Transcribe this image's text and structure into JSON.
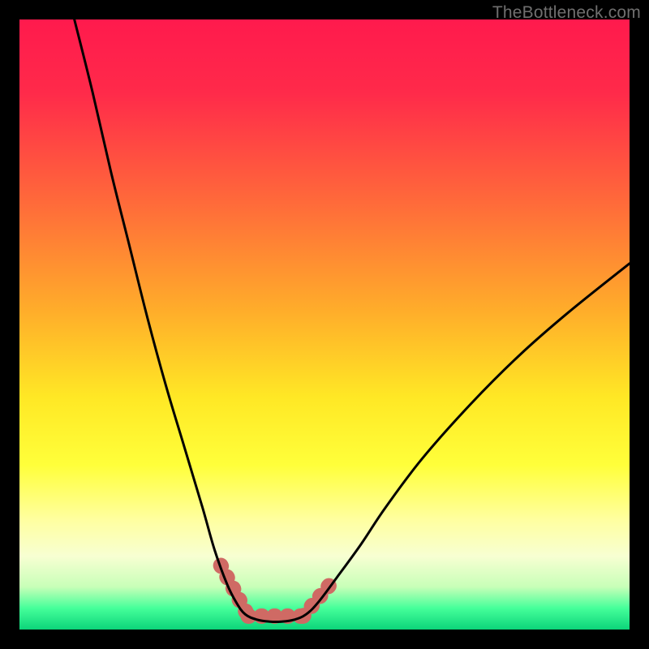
{
  "watermark": "TheBottleneck.com",
  "chart_data": {
    "type": "line",
    "title": "",
    "xlabel": "",
    "ylabel": "",
    "xlim": [
      0,
      100
    ],
    "ylim": [
      0,
      100
    ],
    "curves": [
      {
        "name": "left-limb",
        "x": [
          9,
          12,
          15,
          18,
          21,
          24,
          27,
          30,
          32,
          34,
          35.5,
          37
        ],
        "y": [
          100,
          88,
          75,
          63,
          51,
          40,
          30,
          20,
          13,
          7.5,
          4.5,
          2.5
        ]
      },
      {
        "name": "valley-floor",
        "x": [
          37,
          39,
          41,
          43,
          45,
          47
        ],
        "y": [
          2.5,
          1.6,
          1.3,
          1.3,
          1.6,
          2.5
        ]
      },
      {
        "name": "right-limb",
        "x": [
          47,
          49,
          52,
          56,
          60,
          66,
          74,
          82,
          90,
          100
        ],
        "y": [
          2.5,
          4.5,
          8.5,
          14,
          20,
          28,
          37,
          45,
          52,
          60
        ]
      }
    ],
    "thick_segments": [
      {
        "name": "left-thick",
        "x": [
          33.0,
          37.5
        ],
        "y": [
          10.5,
          2.2
        ]
      },
      {
        "name": "floor-thick",
        "x": [
          37.5,
          46.5
        ],
        "y": [
          2.2,
          2.2
        ]
      },
      {
        "name": "right-thick",
        "x": [
          46.5,
          51.0
        ],
        "y": [
          2.2,
          7.5
        ]
      }
    ],
    "gradient_stops": [
      {
        "offset": 0.0,
        "color": "#ff1a4d"
      },
      {
        "offset": 0.12,
        "color": "#ff2a4a"
      },
      {
        "offset": 0.3,
        "color": "#ff6a3a"
      },
      {
        "offset": 0.48,
        "color": "#ffae2a"
      },
      {
        "offset": 0.62,
        "color": "#ffe825"
      },
      {
        "offset": 0.73,
        "color": "#ffff3a"
      },
      {
        "offset": 0.82,
        "color": "#ffffa0"
      },
      {
        "offset": 0.88,
        "color": "#f7ffd2"
      },
      {
        "offset": 0.93,
        "color": "#c8ffb8"
      },
      {
        "offset": 0.965,
        "color": "#45ff9a"
      },
      {
        "offset": 1.0,
        "color": "#0cd47a"
      }
    ],
    "curve_color": "#000000",
    "thick_color": "#cf6a64"
  }
}
